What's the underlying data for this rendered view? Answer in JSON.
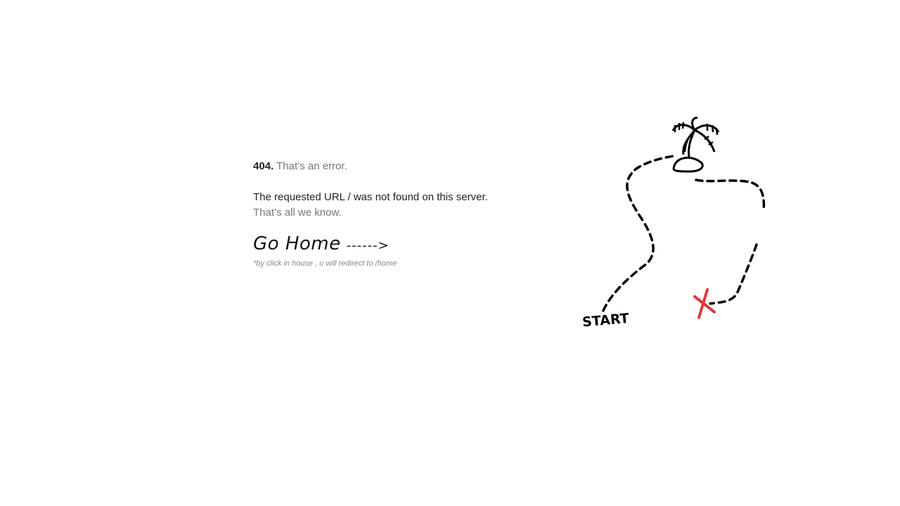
{
  "error": {
    "code": "404.",
    "short": "That’s an error.",
    "message": "The requested URL / was not found on this server.",
    "followup": "That’s all we know."
  },
  "home_link": {
    "label": "Go Home",
    "arrow": "------>",
    "note": "*by click in house , u will redirect to /home"
  },
  "map": {
    "start_label": "START",
    "path_color": "#000000",
    "x_mark_color": "#e03a3a"
  }
}
